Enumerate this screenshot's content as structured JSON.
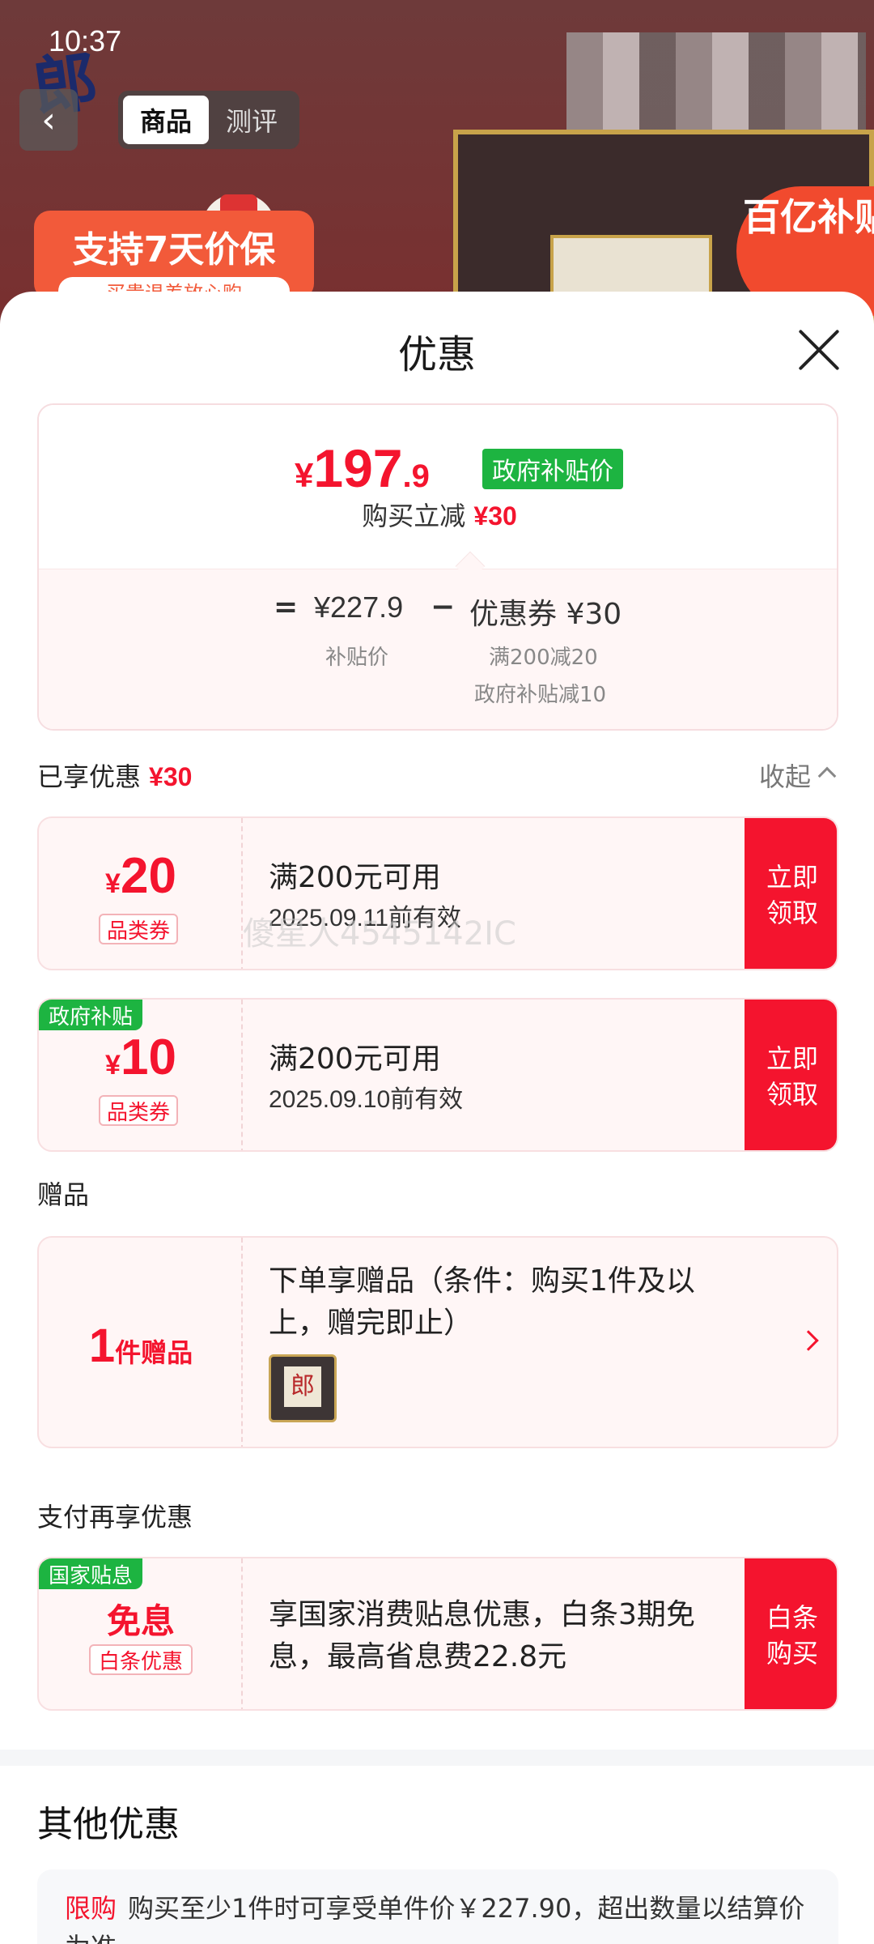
{
  "status": {
    "time": "10:37"
  },
  "background": {
    "logo_char": "郎",
    "tabs": [
      "商品",
      "测评"
    ],
    "promo_line1": "支持7天价保",
    "promo_line2": "买贵退差放心购",
    "subsidy_badge": "百亿补贴"
  },
  "sheet": {
    "title": "优惠",
    "price": {
      "currency": "¥",
      "integer": "197",
      "decimal": ".9",
      "tag": "政府补贴价"
    },
    "reduce": {
      "label": "购买立减",
      "amount": "¥30"
    },
    "formula": {
      "eq": "=",
      "subsidy_price": "¥227.9",
      "subsidy_label": "补贴价",
      "minus": "−",
      "coupon": "优惠券 ¥30",
      "detail1": "满200减20",
      "detail2": "政府补贴减10"
    },
    "enjoyed": {
      "label": "已享优惠",
      "amount": "¥30",
      "collapse": "收起"
    },
    "coupons": [
      {
        "currency": "¥",
        "amount": "20",
        "type": "品类券",
        "condition": "满200元可用",
        "valid": "2025.09.11前有效",
        "cta_line1": "立即",
        "cta_line2": "领取",
        "corner": ""
      },
      {
        "currency": "¥",
        "amount": "10",
        "type": "品类券",
        "condition": "满200元可用",
        "valid": "2025.09.10前有效",
        "cta_line1": "立即",
        "cta_line2": "领取",
        "corner": "政府补贴"
      }
    ],
    "watermark": "傻星人4545142IC",
    "gift": {
      "section": "赠品",
      "count": "1",
      "unit": "件赠品",
      "desc": "下单享赠品（条件：购买1件及以上，赠完即止）",
      "thumb_label": "gift-product-thumbnail"
    },
    "pay": {
      "section": "支付再享优惠",
      "corner": "国家贴息",
      "title": "免息",
      "tag": "白条优惠",
      "desc": "享国家消费贴息优惠，白条3期免息，最高省息费22.8元",
      "cta_line1": "白条",
      "cta_line2": "购买"
    },
    "other": {
      "title": "其他优惠",
      "limit_tag": "限购",
      "limit_text": "购买至少1件时可享受单件价￥227.90，超出数量以结算价为准"
    }
  },
  "colors": {
    "accent": "#f4142e",
    "gov_green": "#1db441",
    "card_bg": "#fff6f6"
  }
}
